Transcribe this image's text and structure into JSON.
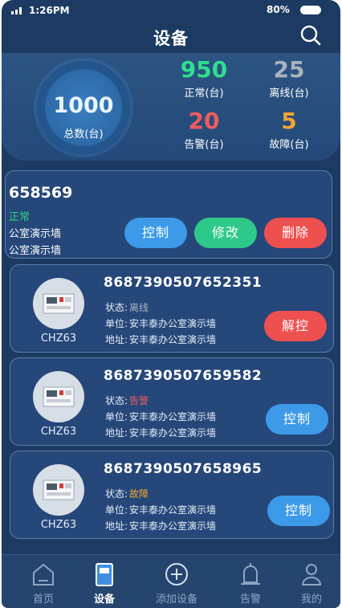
{
  "status_bar": {
    "time": "1:26PM",
    "battery": "80%"
  },
  "header": {
    "title": "设备"
  },
  "summary": {
    "total": {
      "value": "1000",
      "label": "总数(台)"
    },
    "normal": {
      "value": "950",
      "label": "正常(台)",
      "color": "#2ee08d"
    },
    "offline": {
      "value": "25",
      "label": "离线(台)",
      "color": "#a9b2bd"
    },
    "alarm": {
      "value": "20",
      "label": "告警(台)",
      "color": "#f25c5c"
    },
    "fault": {
      "value": "5",
      "label": "故障(台)",
      "color": "#f2a532"
    }
  },
  "first_card": {
    "id": "658569",
    "status": "正常",
    "unit": "公室演示墙",
    "address": "公室演示墙",
    "buttons": {
      "control": "控制",
      "edit": "修改",
      "delete": "删除"
    }
  },
  "devices": [
    {
      "id": "8687390507652351",
      "model": "CHZ63",
      "status_label": "状态:",
      "status": "离线",
      "status_color": "#a9b2bd",
      "unit_label": "单位:",
      "unit": "安丰泰办公室演示墙",
      "address_label": "地址:",
      "address": "安丰泰办公室演示墙",
      "action": "解控"
    },
    {
      "id": "8687390507659582",
      "model": "CHZ63",
      "status_label": "状态:",
      "status": "告警",
      "status_color": "#f25c5c",
      "unit_label": "单位:",
      "unit": "安丰泰办公室演示墙",
      "address_label": "地址:",
      "address": "安丰泰办公室演示墙",
      "action": "控制"
    },
    {
      "id": "8687390507658965",
      "model": "CHZ63",
      "status_label": "状态:",
      "status": "故障",
      "status_color": "#f2a532",
      "unit_label": "单位:",
      "unit": "安丰泰办公室演示墙",
      "address_label": "地址:",
      "address": "安丰泰办公室演示墙",
      "action": "控制"
    }
  ],
  "tabbar": {
    "home": "首页",
    "devices": "设备",
    "add": "添加设备",
    "alarm": "告警",
    "mine": "我的"
  }
}
